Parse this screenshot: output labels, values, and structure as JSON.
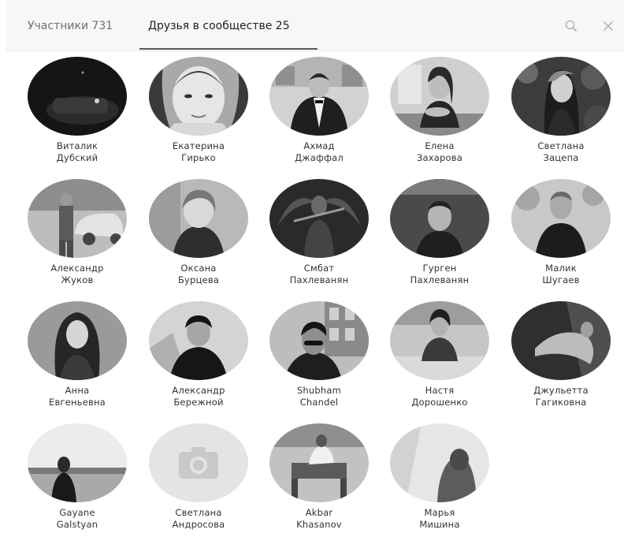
{
  "tabs": [
    {
      "label": "Участники 731",
      "active": false
    },
    {
      "label": "Друзья в сообществе 25",
      "active": true
    }
  ],
  "icons": {
    "search": "search-icon",
    "close": "close-icon"
  },
  "friends": [
    {
      "first": "Виталик",
      "last": "Дубский"
    },
    {
      "first": "Екатерина",
      "last": "Гирько"
    },
    {
      "first": "Ахмад",
      "last": "Джаффал"
    },
    {
      "first": "Елена",
      "last": "Захарова"
    },
    {
      "first": "Светлана",
      "last": "Зацепа"
    },
    {
      "first": "Александр",
      "last": "Жуков"
    },
    {
      "first": "Оксана",
      "last": "Бурцева"
    },
    {
      "first": "Смбат",
      "last": "Пахлеванян"
    },
    {
      "first": "Гурген",
      "last": "Пахлеванян"
    },
    {
      "first": "Малик",
      "last": "Шугаев"
    },
    {
      "first": "Анна",
      "last": "Евгеньевна"
    },
    {
      "first": "Александр",
      "last": "Бережной"
    },
    {
      "first": "Shubham",
      "last": "Chandel"
    },
    {
      "first": "Настя",
      "last": "Дорошенко"
    },
    {
      "first": "Джульетта",
      "last": "Гагиковна"
    },
    {
      "first": "Gayane",
      "last": "Galstyan"
    },
    {
      "first": "Светлана",
      "last": "Андросова"
    },
    {
      "first": "Akbar",
      "last": "Khasanov"
    },
    {
      "first": "Марья",
      "last": "Мишина"
    }
  ]
}
